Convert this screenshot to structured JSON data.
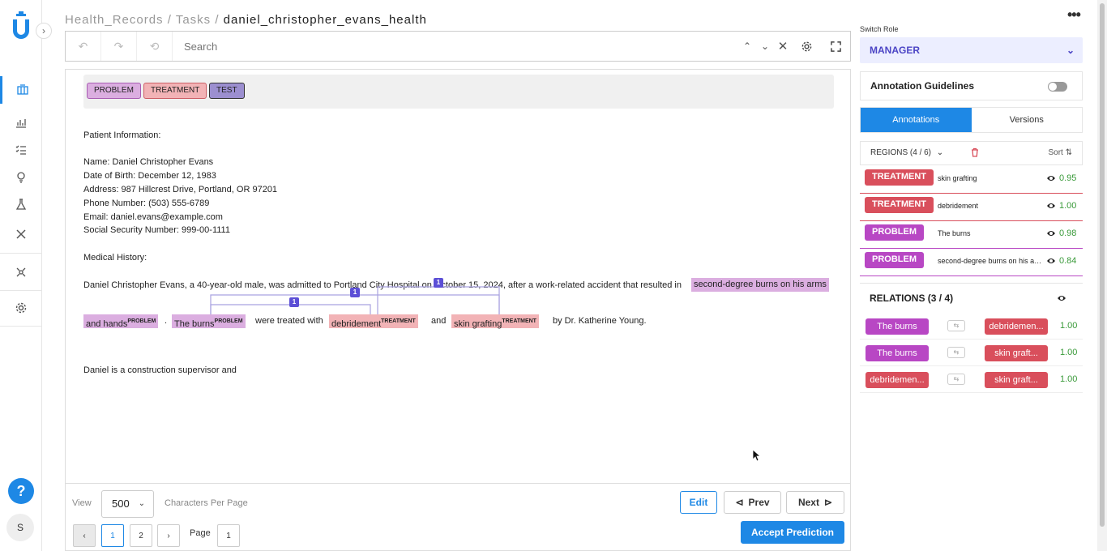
{
  "breadcrumb": {
    "part1": "Health_Records /",
    "part2": "Tasks /",
    "current": "daniel_christopher_evans_health"
  },
  "toolbar": {
    "search_placeholder": "Search"
  },
  "labels": [
    {
      "text": "PROBLEM",
      "bg": "#dbaee0",
      "border": "#a85cb3"
    },
    {
      "text": "TREATMENT",
      "bg": "#f2b3b6",
      "border": "#cc5e66"
    },
    {
      "text": "TEST",
      "bg": "#9c8fd0",
      "border": "#333"
    }
  ],
  "document": {
    "patient_info_heading": "Patient Information:",
    "name": "Name: Daniel Christopher Evans",
    "dob": "Date of Birth: December 12, 1983",
    "address": "Address: 987 Hillcrest Drive, Portland, OR 97201",
    "phone": "Phone Number: (503) 555-6789",
    "email": "Email: daniel.evans@example.com",
    "ssn": "Social Security Number: 999-00-1111",
    "history_heading": "Medical History:",
    "sentence_start": "Daniel Christopher Evans, a 40-year-old male, was admitted to Portland City Hospital on October 15, 2024, after a work-related accident that resulted in",
    "entity1_a": "second-degree burns on his arms",
    "entity1_b": "and hands",
    "entity1_tag": "PROBLEM",
    "period": ".",
    "entity2": "The burns",
    "entity2_tag": "PROBLEM",
    "were_treated": "were treated with",
    "entity3": "debridement",
    "entity3_tag": "TREATMENT",
    "and": "and",
    "entity4": "skin grafting",
    "entity4_tag": "TREATMENT",
    "by_doctor": "by Dr. Katherine Young.",
    "last_line": "Daniel is a construction supervisor and",
    "rel_badges": [
      "1",
      "1",
      "1"
    ]
  },
  "footer": {
    "view_label": "View",
    "view_value": "500",
    "chars_label": "Characters Per Page",
    "edit": "Edit",
    "prev": "Prev",
    "next": "Next",
    "accept": "Accept Prediction",
    "pages": [
      "1",
      "2"
    ],
    "page_label": "Page",
    "page_input": "1"
  },
  "right": {
    "switch_role_label": "Switch Role",
    "role": "MANAGER",
    "guidelines": "Annotation Guidelines",
    "tabs": [
      "Annotations",
      "Versions"
    ],
    "regions_head": "REGIONS (4 / 6)",
    "sort": "Sort",
    "regions": [
      {
        "tag": "TREATMENT",
        "text": "skin grafting",
        "score": "0.95",
        "color": "#d94f5c"
      },
      {
        "tag": "TREATMENT",
        "text": "debridement",
        "score": "1.00",
        "color": "#d94f5c"
      },
      {
        "tag": "PROBLEM",
        "text": "The burns",
        "score": "0.98",
        "color": "#b847c4"
      },
      {
        "tag": "PROBLEM",
        "text": "second-degree burns on his arms and hands",
        "score": "0.84",
        "color": "#b847c4"
      }
    ],
    "relations_head": "RELATIONS (3 / 4)",
    "relations": [
      {
        "from": "The burns",
        "from_color": "#b847c4",
        "to": "debridemen...",
        "to_color": "#d94f5c",
        "score": "1.00"
      },
      {
        "from": "The burns",
        "from_color": "#b847c4",
        "to": "skin graft...",
        "to_color": "#d94f5c",
        "score": "1.00"
      },
      {
        "from": "debridemen...",
        "from_color": "#d94f5c",
        "to": "skin graft...",
        "to_color": "#d94f5c",
        "score": "1.00"
      }
    ]
  },
  "user_initial": "S"
}
